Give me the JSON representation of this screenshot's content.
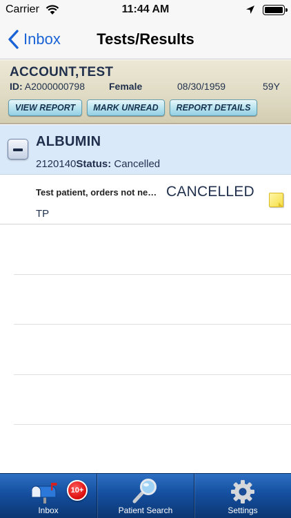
{
  "status_bar": {
    "carrier": "Carrier",
    "time": "11:44 AM"
  },
  "nav": {
    "back_label": "Inbox",
    "title": "Tests/Results"
  },
  "patient": {
    "name": "ACCOUNT,TEST",
    "id_label": "ID:",
    "id_value": "A2000000798",
    "sex": "Female",
    "dob": "08/30/1959",
    "age": "59Y"
  },
  "header_buttons": {
    "view_report": "VIEW REPORT",
    "mark_unread": "MARK UNREAD",
    "report_details": "REPORT DETAILS"
  },
  "test": {
    "name": "ALBUMIN",
    "number": "2120140",
    "status_label": "Status:",
    "status_value": "Cancelled"
  },
  "result": {
    "comment": "Test patient, orders not ne…",
    "status": "CANCELLED",
    "code": "TP"
  },
  "tabs": [
    {
      "label": "Inbox",
      "icon": "mailbox-icon",
      "badge": "10+"
    },
    {
      "label": "Patient Search",
      "icon": "magnifier-icon"
    },
    {
      "label": "Settings",
      "icon": "gear-icon"
    }
  ],
  "colors": {
    "nav_tint": "#1a63d6",
    "text_dark": "#1f2f4c",
    "test_section_bg": "#dae9f9",
    "tab_bar": "#154f9f",
    "badge": "#e01515"
  }
}
